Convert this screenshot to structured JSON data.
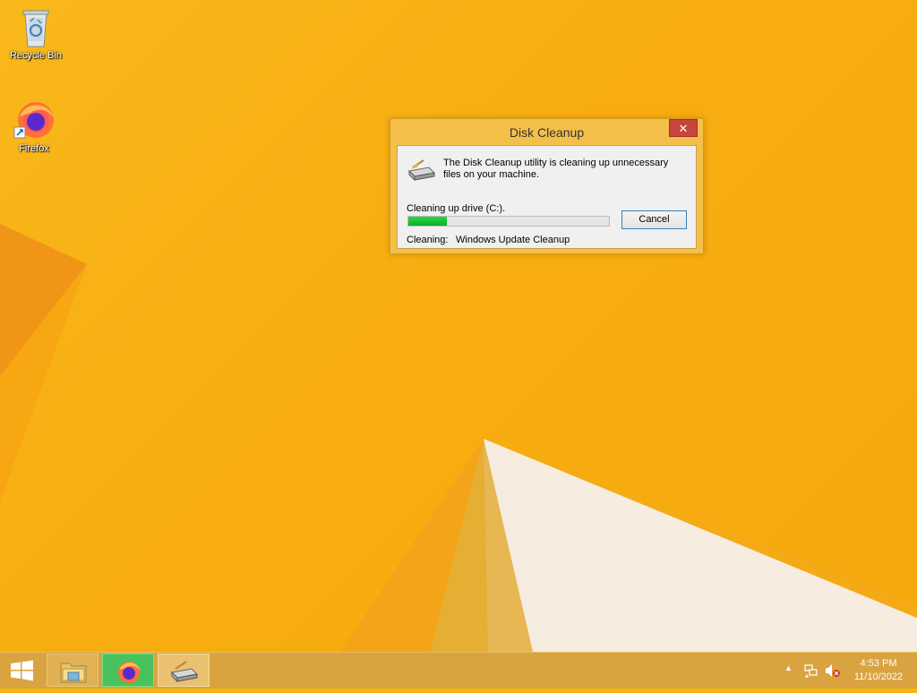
{
  "desktop": {
    "icons": [
      {
        "label": "Recycle Bin",
        "icon": "recycle-bin-icon"
      },
      {
        "label": "Firefox",
        "icon": "firefox-icon"
      }
    ]
  },
  "dialog": {
    "title": "Disk Cleanup",
    "close_symbol": "✕",
    "message": "The Disk Cleanup utility is cleaning up unnecessary files on your machine.",
    "drive_line": "Cleaning up drive  (C:).",
    "progress_percent": 19,
    "cancel_label": "Cancel",
    "cleaning_label": "Cleaning:",
    "cleaning_value": "Windows Update Cleanup"
  },
  "taskbar": {
    "buttons": [
      {
        "name": "File Explorer",
        "icon": "file-explorer-icon"
      },
      {
        "name": "Firefox",
        "icon": "firefox-icon",
        "state": "active"
      },
      {
        "name": "Disk Cleanup",
        "icon": "disk-cleanup-icon"
      }
    ],
    "tray": {
      "chevron": "▲",
      "icons": [
        "network-icon",
        "volume-muted-icon"
      ]
    },
    "clock": {
      "time": "4:53 PM",
      "date": "11/10/2022"
    }
  },
  "colors": {
    "wallpaper": "#f8b311",
    "dialog_frame": "#f4c04a",
    "close_button": "#c7463b",
    "progress_fill": "#07b025",
    "taskbar": "#d9a340",
    "active_task": "#47c25c"
  }
}
